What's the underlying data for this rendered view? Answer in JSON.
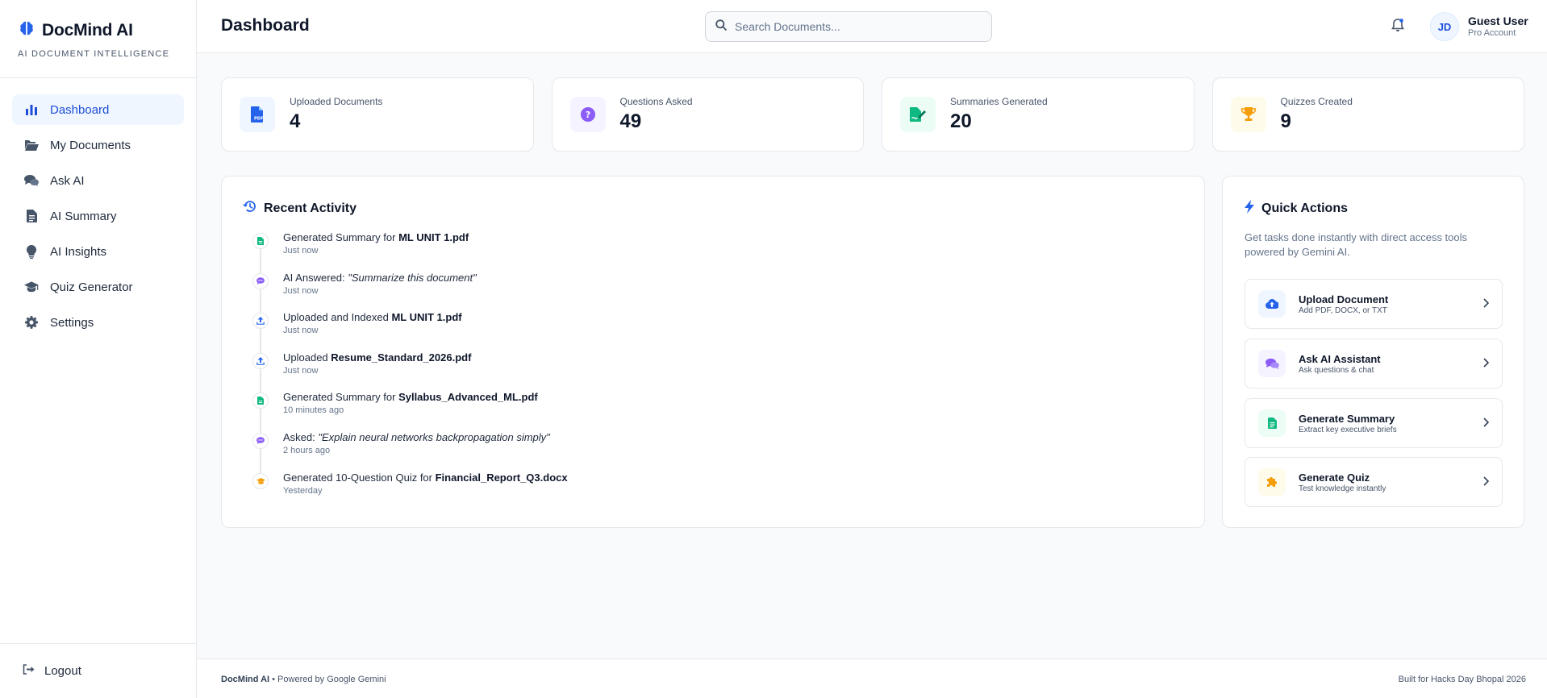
{
  "sidebar": {
    "brand": "DocMind AI",
    "tagline": "AI DOCUMENT INTELLIGENCE",
    "items": [
      {
        "label": "Dashboard",
        "icon": "bar-chart-icon"
      },
      {
        "label": "My Documents",
        "icon": "folder-open-icon"
      },
      {
        "label": "Ask AI",
        "icon": "chat-bubbles-icon"
      },
      {
        "label": "AI Summary",
        "icon": "document-text-icon"
      },
      {
        "label": "AI Insights",
        "icon": "lightbulb-icon"
      },
      {
        "label": "Quiz Generator",
        "icon": "graduation-cap-icon"
      },
      {
        "label": "Settings",
        "icon": "gear-icon"
      }
    ],
    "active": "Dashboard",
    "logout": "Logout"
  },
  "header": {
    "title": "Dashboard",
    "search_placeholder": "Search Documents...",
    "user_initials": "JD",
    "user_name": "Guest User",
    "user_role": "Pro Account"
  },
  "stats": [
    {
      "label": "Uploaded Documents",
      "value": "4",
      "icon": "pdf-file-icon",
      "color": "#2563eb",
      "bg": "#eff6ff"
    },
    {
      "label": "Questions Asked",
      "value": "49",
      "icon": "question-circle-icon",
      "color": "#8b5cf6",
      "bg": "#f5f3ff"
    },
    {
      "label": "Summaries Generated",
      "value": "20",
      "icon": "file-signature-icon",
      "color": "#10b981",
      "bg": "#ecfdf5"
    },
    {
      "label": "Quizzes Created",
      "value": "9",
      "icon": "trophy-icon",
      "color": "#f59e0b",
      "bg": "#fffbeb"
    }
  ],
  "recent": {
    "title": "Recent Activity",
    "items": [
      {
        "prefix": "Generated Summary for ",
        "target": "ML UNIT 1.pdf",
        "quote": "",
        "time": "Just now",
        "icon": "file-icon",
        "color": "#10b981"
      },
      {
        "prefix": "AI Answered: ",
        "target": "",
        "quote": "\"Summarize this document\"",
        "time": "Just now",
        "icon": "chat-icon",
        "color": "#8b5cf6"
      },
      {
        "prefix": "Uploaded and Indexed ",
        "target": "ML UNIT 1.pdf",
        "quote": "",
        "time": "Just now",
        "icon": "upload-icon",
        "color": "#2563eb"
      },
      {
        "prefix": "Uploaded ",
        "target": "Resume_Standard_2026.pdf",
        "quote": "",
        "time": "Just now",
        "icon": "upload-icon",
        "color": "#2563eb"
      },
      {
        "prefix": "Generated Summary for ",
        "target": "Syllabus_Advanced_ML.pdf",
        "quote": "",
        "time": "10 minutes ago",
        "icon": "file-icon",
        "color": "#10b981"
      },
      {
        "prefix": "Asked: ",
        "target": "",
        "quote": "\"Explain neural networks backpropagation simply\"",
        "time": "2 hours ago",
        "icon": "chat-icon",
        "color": "#8b5cf6"
      },
      {
        "prefix": "Generated 10-Question Quiz for ",
        "target": "Financial_Report_Q3.docx",
        "quote": "",
        "time": "Yesterday",
        "icon": "graduation-cap-icon",
        "color": "#f59e0b"
      }
    ]
  },
  "quick": {
    "title": "Quick Actions",
    "description": "Get tasks done instantly with direct access tools powered by Gemini AI.",
    "actions": [
      {
        "title": "Upload Document",
        "subtitle": "Add PDF, DOCX, or TXT",
        "icon": "cloud-upload-icon",
        "color": "#2563eb",
        "bg": "#eff6ff"
      },
      {
        "title": "Ask AI Assistant",
        "subtitle": "Ask questions & chat",
        "icon": "chat-bubbles-icon",
        "color": "#8b5cf6",
        "bg": "#f5f3ff"
      },
      {
        "title": "Generate Summary",
        "subtitle": "Extract key executive briefs",
        "icon": "document-text-icon",
        "color": "#10b981",
        "bg": "#ecfdf5"
      },
      {
        "title": "Generate Quiz",
        "subtitle": "Test knowledge instantly",
        "icon": "puzzle-icon",
        "color": "#f59e0b",
        "bg": "#fffbeb"
      }
    ]
  },
  "footer": {
    "brand": "DocMind AI",
    "powered": " • Powered by Google Gemini",
    "credit": "Built for Hacks Day Bhopal 2026"
  }
}
